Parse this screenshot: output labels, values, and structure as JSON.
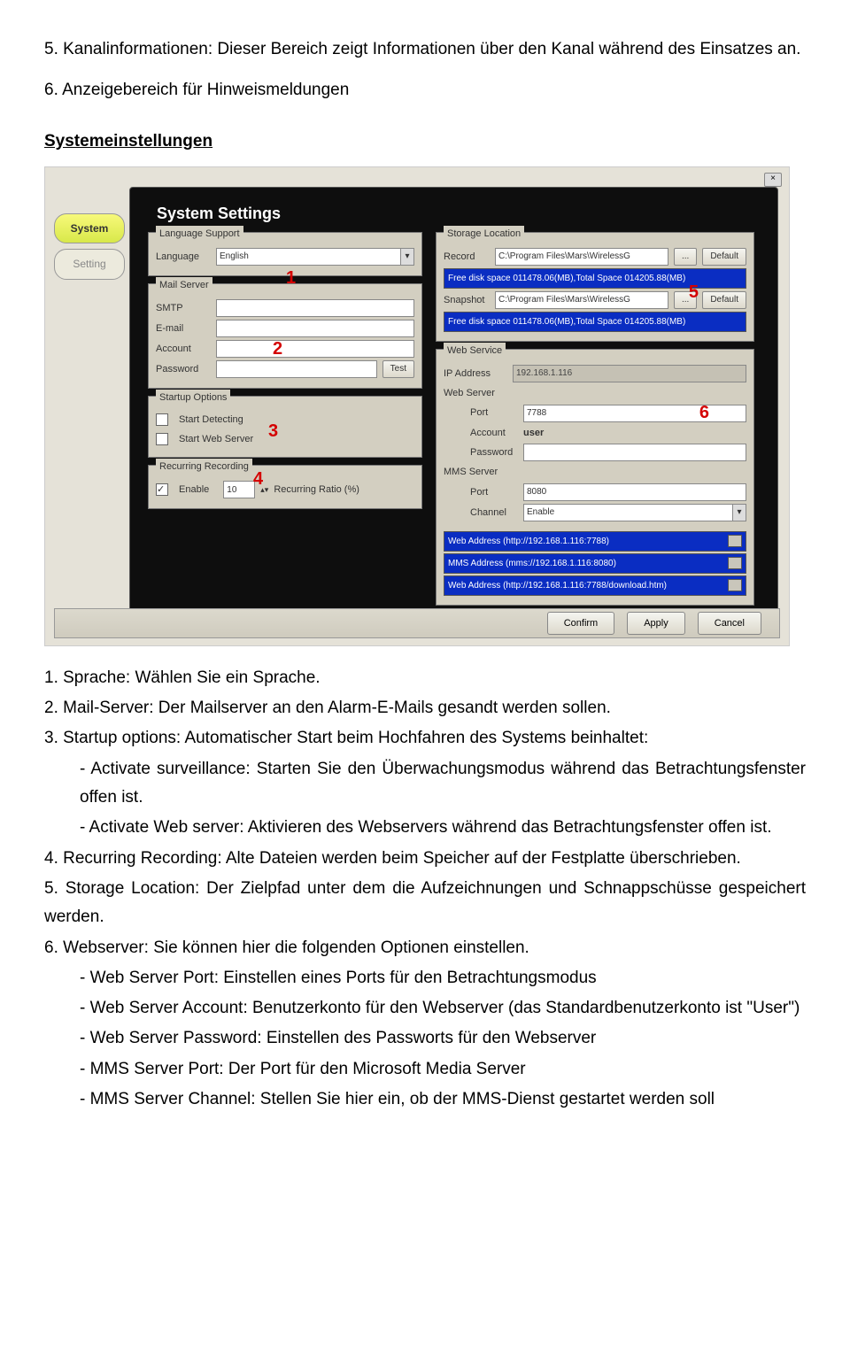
{
  "doc": {
    "p5": "5. Kanalinformationen: Dieser Bereich zeigt Informationen über den Kanal während des Einsatzes an.",
    "p6": "6. Anzeigebereich für Hinweismeldungen",
    "h1": "Systemeinstellungen",
    "n1": "1. Sprache: Wählen Sie ein Sprache.",
    "n2": "2. Mail-Server: Der Mailserver an den Alarm-E-Mails gesandt werden sollen.",
    "n3": "3. Startup options: Automatischer Start beim Hochfahren des Systems beinhaltet:",
    "n3a": "-   Activate surveillance: Starten Sie den Überwachungsmodus während das Betrachtungsfenster offen ist.",
    "n3b": "-   Activate Web server: Aktivieren des Webservers während das Betrachtungsfenster offen ist.",
    "n4": "4. Recurring Recording: Alte Dateien werden beim Speicher auf der Festplatte überschrieben.",
    "n5": "5. Storage Location: Der Zielpfad unter dem die Aufzeichnungen und Schnappschüsse gespeichert werden.",
    "n6": "6. Webserver: Sie können hier die folgenden Optionen einstellen.",
    "n6a": "- Web Server Port: Einstellen eines Ports für den Betrachtungsmodus",
    "n6b": "- Web Server Account: Benutzerkonto für den Webserver (das Standardbenutzerkonto ist \"User\")",
    "n6c": "- Web Server Password: Einstellen des Passworts für den Webserver",
    "n6d": "- MMS Server Port: Der Port für den Microsoft Media Server",
    "n6e": "- MMS Server Channel: Stellen Sie hier ein, ob der MMS-Dienst gestartet werden soll"
  },
  "ui": {
    "close": "×",
    "tab_system": "System",
    "tab_setting": "Setting",
    "panel_title": "System Settings",
    "lang_group": "Language Support",
    "lang_label": "Language",
    "lang_value": "English",
    "mail_group": "Mail Server",
    "mail_smtp": "SMTP",
    "mail_email": "E-mail",
    "mail_account": "Account",
    "mail_password": "Password",
    "mail_test": "Test",
    "startup_group": "Startup Options",
    "startup_detect": "Start Detecting",
    "startup_web": "Start Web Server",
    "recur_group": "Recurring Recording",
    "recur_enable": "Enable",
    "recur_value": "10",
    "recur_ratio": "Recurring Ratio (%)",
    "storage_group": "Storage Location",
    "storage_record": "Record",
    "storage_snapshot": "Snapshot",
    "storage_path": "C:\\Program Files\\Mars\\WirelessG",
    "storage_browse": "...",
    "storage_default": "Default",
    "storage_free": "Free disk space 011478.06(MB),Total Space 014205.88(MB)",
    "web_group": "Web Service",
    "web_ip_label": "IP Address",
    "web_ip_value": "192.168.1.116",
    "web_server_label": "Web Server",
    "web_port_label": "Port",
    "web_port_value": "7788",
    "web_account_label": "Account",
    "web_account_value": "user",
    "web_password_label": "Password",
    "mms_label": "MMS Server",
    "mms_port_label": "Port",
    "mms_port_value": "8080",
    "mms_channel_label": "Channel",
    "mms_channel_value": "Enable",
    "addr1": "Web Address  (http://192.168.1.116:7788)",
    "addr2": "MMS Address  (mms://192.168.1.116:8080)",
    "addr3": "Web Address  (http://192.168.1.116:7788/download.htm)",
    "btn_confirm": "Confirm",
    "btn_apply": "Apply",
    "btn_cancel": "Cancel",
    "red1": "1",
    "red2": "2",
    "red3": "3",
    "red4": "4",
    "red5": "5",
    "red6": "6"
  }
}
